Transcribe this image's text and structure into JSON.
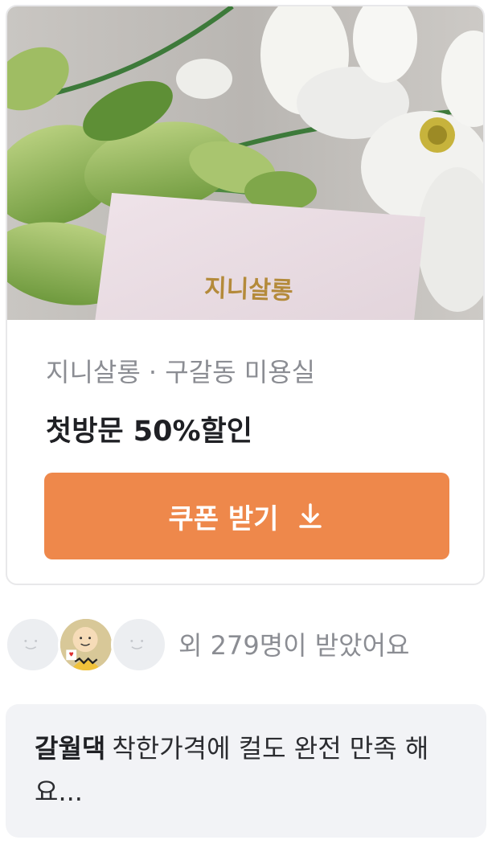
{
  "coupon": {
    "hero_brand_text": "지니살롱",
    "store_meta": "지니살롱 · 구갈동 미용실",
    "offer_title": "첫방문 50%할인",
    "button_label": "쿠폰 받기",
    "button_color": "#ee884b",
    "button_icon": "download-icon"
  },
  "recipients": {
    "summary": "외 279명이 받았어요",
    "avatars": [
      "default-avatar",
      "cartoon-avatar",
      "default-avatar"
    ]
  },
  "review": {
    "author": "갈월댁",
    "text": "착한가격에 컬도 완전 만족 해요..."
  }
}
